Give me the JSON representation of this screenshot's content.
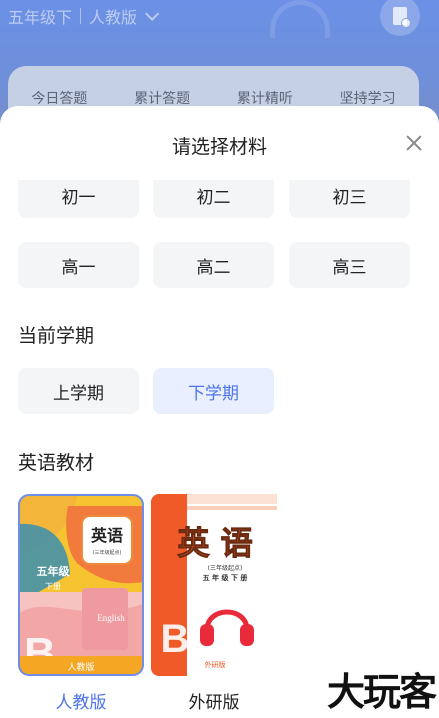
{
  "background": {
    "grade_label": "五年级下",
    "edition_label": "人教版",
    "stats": [
      "今日答题",
      "累计答题",
      "累计精听",
      "坚持学习"
    ]
  },
  "sheet": {
    "title": "请选择材料",
    "grade_row1": [
      "初一",
      "初二",
      "初三"
    ],
    "grade_row2": [
      "高一",
      "高二",
      "高三"
    ],
    "semester_section": "当前学期",
    "semesters": [
      "上学期",
      "下学期"
    ],
    "selected_semester": "下学期",
    "textbook_section": "英语教材",
    "textbooks": [
      {
        "label": "人教版",
        "cover_title": "英语",
        "cover_sub": "(三年级起点)",
        "cover_grade": "五年级",
        "cover_vol": "下册",
        "cover_word": "English",
        "cover_footer": "人教版"
      },
      {
        "label": "外研版",
        "cover_title": "英 语",
        "cover_sub": "(三年级起点)",
        "cover_grade": "五 年 级 下 册",
        "cover_footer": "外研版"
      }
    ],
    "selected_textbook": "人教版"
  },
  "colors": {
    "accent": "#4d74e8",
    "chip_bg": "#f4f5f7",
    "selected_bg": "#e9efff"
  },
  "watermark": "大玩客"
}
